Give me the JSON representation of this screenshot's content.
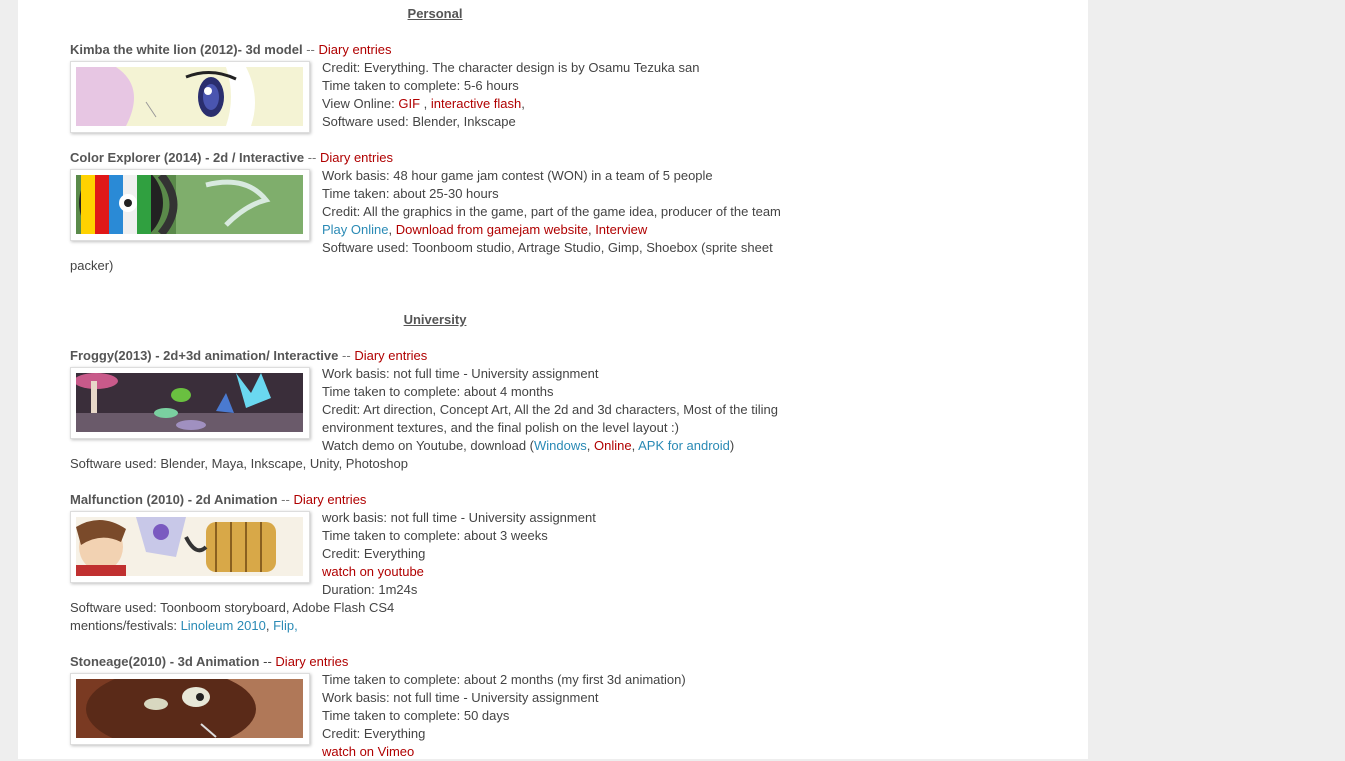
{
  "sections": {
    "personal": "Personal",
    "university": "University"
  },
  "sep": "--",
  "comma": ",",
  "diary": "Diary entries",
  "kimba": {
    "title": "Kimba the white lion (2012)- 3d model",
    "credit": "Credit: Everything. The character design is by Osamu Tezuka san",
    "time": "Time taken to complete: 5-6 hours",
    "view_prefix": "View Online:",
    "gif": "GIF",
    "flash": "interactive flash",
    "software": "Software used: Blender, Inkscape"
  },
  "color": {
    "title": "Color Explorer (2014) - 2d / Interactive",
    "work": "Work basis: 48 hour game jam contest (WON) in a team of 5 people",
    "time": "Time taken: about 25-30 hours",
    "credit": "Credit: All the graphics in the game, part of the game idea, producer of the team",
    "play": "Play Online",
    "download": "Download from gamejam website",
    "interview": "Interview",
    "software1": "Software used: Toonboom studio, Artrage Studio, Gimp, Shoebox (sprite sheet",
    "software2": "packer)"
  },
  "froggy": {
    "title": "Froggy(2013) - 2d+3d animation/ Interactive",
    "work": "Work basis: not full time - University assignment",
    "time": "Time taken to complete: about 4 months",
    "credit1": "Credit: Art direction, Concept Art, All the 2d and 3d characters, Most of the tiling",
    "credit2": "environment textures, and the final polish on the level layout :)",
    "watch_prefix": "Watch demo on Youtube, download (",
    "windows": "Windows",
    "online": "Online",
    "apk": "APK for android",
    "close": ")",
    "software": "Software used: Blender, Maya, Inkscape, Unity, Photoshop"
  },
  "malfunction": {
    "title": "Malfunction (2010) - 2d Animation",
    "work": "work basis: not full time - University assignment",
    "time": "Time taken to complete: about 3 weeks",
    "credit": "Credit: Everything",
    "watch": "watch on youtube",
    "duration": "Duration: 1m24s",
    "software": "Software used: Toonboom storyboard, Adobe Flash CS4",
    "festivals_prefix": "mentions/festivals:",
    "linoleum": "Linoleum 2010",
    "flip": "Flip"
  },
  "stoneage": {
    "title": "Stoneage(2010) - 3d Animation",
    "time1": "Time taken to complete: about 2 months (my first 3d animation)",
    "work": "Work basis: not full time - University assignment",
    "time2": "Time taken to complete: 50 days",
    "credit": "Credit: Everything",
    "watch": "watch on Vimeo"
  }
}
